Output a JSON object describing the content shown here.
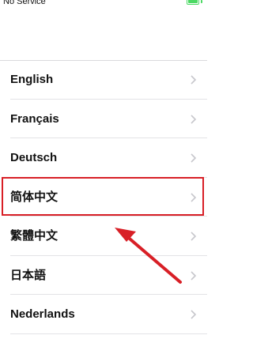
{
  "status_bar": {
    "carrier": "No Service",
    "battery_level": 1.0
  },
  "languages": [
    {
      "label": "English"
    },
    {
      "label": "Français"
    },
    {
      "label": "Deutsch"
    },
    {
      "label": "简体中文"
    },
    {
      "label": "繁體中文"
    },
    {
      "label": "日本語"
    },
    {
      "label": "Nederlands"
    }
  ],
  "highlighted_item": "简体中文",
  "colors": {
    "highlight": "#d81f26",
    "battery": "#4cd964",
    "separator": "#e3e3e6",
    "chevron": "#c7c7cc"
  },
  "icons": {
    "row_chevron": "chevron-right-icon",
    "annotation": "arrow-annotation-icon"
  }
}
